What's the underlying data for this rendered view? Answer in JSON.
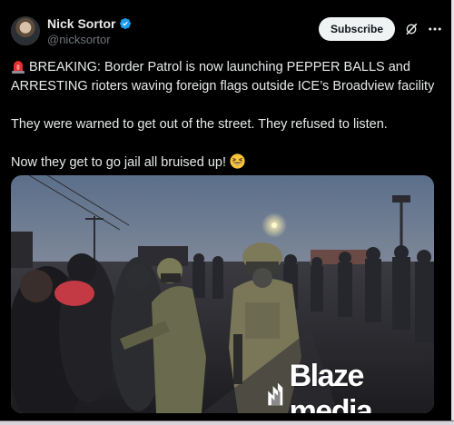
{
  "post": {
    "author": {
      "display_name": "Nick Sortor",
      "handle": "@nicksortor",
      "verified": true
    },
    "subscribe_label": "Subscribe",
    "icons": {
      "verified": "verified-badge-icon",
      "grok": "grok-icon",
      "more": "more-options-icon",
      "siren": "rotating-light-emoji",
      "grin": "grinning-squinting-face-emoji"
    },
    "text": {
      "line1": "BREAKING: Border Patrol is now launching PEPPER BALLS and ARRESTING rioters waving foreign flags outside ICE’s Broadview facility",
      "line2": "They were warned to get out of the street. They refused to listen.",
      "line3": "Now they get to go jail all bruised up!"
    },
    "media": {
      "watermark": "Blaze media"
    }
  },
  "colors": {
    "background": "#000000",
    "text": "#e7e9ea",
    "secondary_text": "#71767b",
    "verified_blue": "#1d9bf0",
    "subscribe_bg": "#eff3f4"
  }
}
